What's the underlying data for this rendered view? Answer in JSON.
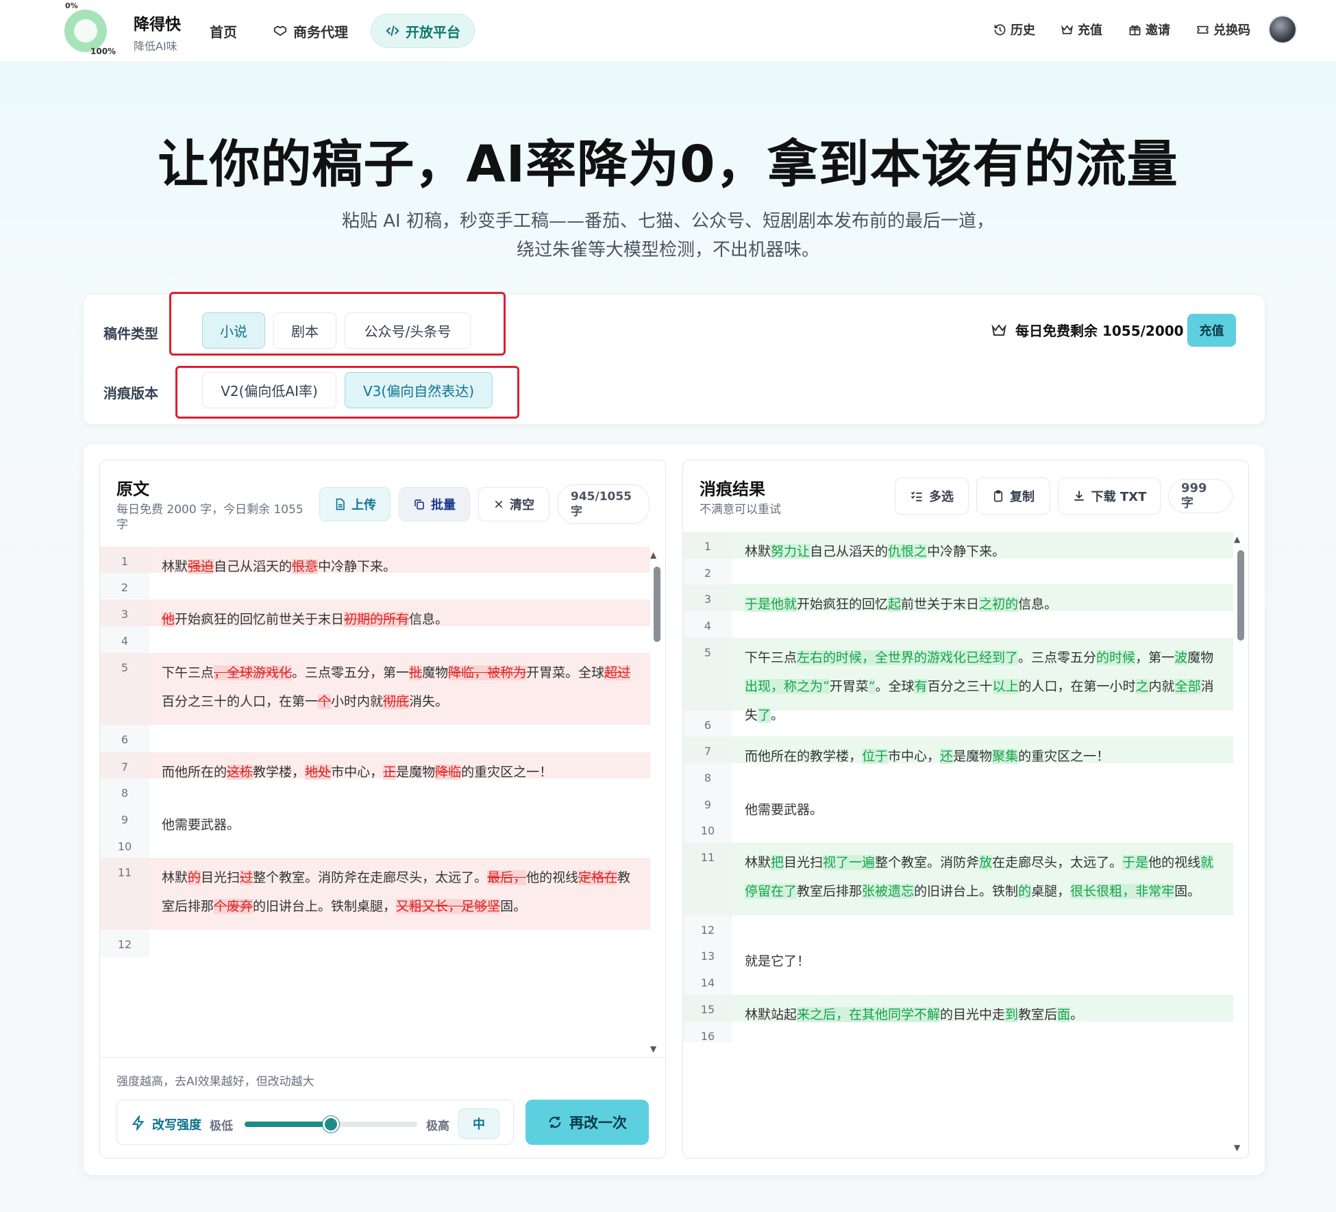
{
  "header": {
    "progress_top": "0%",
    "progress_bottom": "100%",
    "brand_name": "降得快",
    "brand_sub": "降低AI味",
    "nav": [
      "首页",
      "商务代理",
      "开放平台"
    ],
    "right": [
      "历史",
      "充值",
      "邀请",
      "兑换码"
    ]
  },
  "hero": {
    "title": "让你的稿子，AI率降为0，拿到本该有的流量",
    "sub1": "粘贴 AI 初稿，秒变手工稿——番茄、七猫、公众号、短剧剧本发布前的最后一道，",
    "sub2": "绕过朱雀等大模型检测，不出机器味。"
  },
  "settings": {
    "type_label": "稿件类型",
    "types": [
      "小说",
      "剧本",
      "公众号/头条号"
    ],
    "version_label": "消痕版本",
    "versions": [
      "V2(偏向低AI率)",
      "V3(偏向自然表达)"
    ],
    "quota": "每日免费剩余 1055/2000 字",
    "recharge": "充值"
  },
  "left": {
    "title": "原文",
    "sub": "每日免费 2000 字，今日剩余 1055 字",
    "upload": "上传",
    "batch": "批量",
    "clear": "清空",
    "count": "945/1055 字",
    "hint": "强度越高，去AI效果越好，但改动越大",
    "strength_label": "改写强度",
    "low": "极低",
    "high": "极高",
    "level": "中",
    "strength_value": 0.5,
    "again": "再改一次"
  },
  "right": {
    "title": "消痕结果",
    "sub": "不满意可以重试",
    "multi": "多选",
    "copy": "复制",
    "download": "下载 TXT",
    "count": "999 字"
  },
  "colors": {
    "accent": "#5dcfdf",
    "teal_text": "#0e7490",
    "deleted": "#dc2626",
    "inserted": "#16a34a",
    "highlight_box": "#e11d2e"
  },
  "left_lines": [
    {
      "n": "1",
      "segs": [
        [
          "",
          "林默"
        ],
        [
          "d",
          "强迫"
        ],
        [
          "",
          "自己从滔天的"
        ],
        [
          "d",
          "恨意"
        ],
        [
          "",
          "中冷静下来。"
        ]
      ]
    },
    {
      "n": "2",
      "segs": []
    },
    {
      "n": "3",
      "segs": [
        [
          "d",
          "他"
        ],
        [
          "",
          "开始疯狂的回忆前世关于末日"
        ],
        [
          "d",
          "初期的所有"
        ],
        [
          "",
          "信息。"
        ]
      ]
    },
    {
      "n": "4",
      "segs": []
    },
    {
      "n": "5",
      "segs": [
        [
          "",
          "下午三点"
        ],
        [
          "d",
          "，全球游戏化"
        ],
        [
          "",
          "。三点零五分，第一"
        ],
        [
          "d",
          "批"
        ],
        [
          "",
          "魔物"
        ],
        [
          "d",
          "降临，被称为"
        ],
        [
          "",
          "开胃菜。全球"
        ],
        [
          "d",
          "超过"
        ],
        [
          "",
          "百分之三十的人口，在第一"
        ],
        [
          "d",
          "个"
        ],
        [
          "",
          "小时内就"
        ],
        [
          "d",
          "彻底"
        ],
        [
          "",
          "消失。"
        ]
      ]
    },
    {
      "n": "6",
      "segs": []
    },
    {
      "n": "7",
      "segs": [
        [
          "",
          "而他所在的"
        ],
        [
          "d",
          "这栋"
        ],
        [
          "",
          "教学楼，"
        ],
        [
          "d",
          "地处"
        ],
        [
          "",
          "市中心，"
        ],
        [
          "d",
          "正"
        ],
        [
          "",
          "是魔物"
        ],
        [
          "d",
          "降临"
        ],
        [
          "",
          "的重灾区之一！"
        ]
      ]
    },
    {
      "n": "8",
      "segs": []
    },
    {
      "n": "9",
      "segs": [
        [
          "",
          "他需要武器。"
        ]
      ]
    },
    {
      "n": "10",
      "segs": []
    },
    {
      "n": "11",
      "segs": [
        [
          "",
          "林默"
        ],
        [
          "d",
          "的"
        ],
        [
          "",
          "目光扫"
        ],
        [
          "d",
          "过"
        ],
        [
          "",
          "整个教室。消防斧在走廊尽头，太远了。"
        ],
        [
          "d",
          "最后，"
        ],
        [
          "",
          "他的视线"
        ],
        [
          "d",
          "定格在"
        ],
        [
          "",
          "教室后排那"
        ],
        [
          "d",
          "个废弃"
        ],
        [
          "",
          "的旧讲台上。铁制桌腿，"
        ],
        [
          "d",
          "又粗又长，足够坚"
        ],
        [
          "",
          "固。"
        ]
      ]
    },
    {
      "n": "12",
      "segs": []
    }
  ],
  "right_lines": [
    {
      "n": "1",
      "segs": [
        [
          "",
          "林默"
        ],
        [
          "i",
          "努力让"
        ],
        [
          "",
          "自己从滔天的"
        ],
        [
          "i",
          "仇恨之"
        ],
        [
          "",
          "中冷静下来。"
        ]
      ]
    },
    {
      "n": "2",
      "segs": []
    },
    {
      "n": "3",
      "segs": [
        [
          "i",
          "于是他就"
        ],
        [
          "",
          "开始疯狂的回忆"
        ],
        [
          "i",
          "起"
        ],
        [
          "",
          "前世关于末日"
        ],
        [
          "i",
          "之初的"
        ],
        [
          "",
          "信息。"
        ]
      ]
    },
    {
      "n": "4",
      "segs": []
    },
    {
      "n": "5",
      "segs": [
        [
          "",
          "下午三点"
        ],
        [
          "i",
          "左右的时候，全世界的游戏化已经到了"
        ],
        [
          "",
          "。三点零五分"
        ],
        [
          "i",
          "的时候"
        ],
        [
          "",
          "，第一"
        ],
        [
          "i",
          "波"
        ],
        [
          "",
          "魔物"
        ],
        [
          "i",
          "出现，称之为“"
        ],
        [
          "",
          "开胃菜"
        ],
        [
          "i",
          "”"
        ],
        [
          "",
          "。全球"
        ],
        [
          "i",
          "有"
        ],
        [
          "",
          "百分之三十"
        ],
        [
          "i",
          "以上"
        ],
        [
          "",
          "的人口，在第一小时"
        ],
        [
          "i",
          "之"
        ],
        [
          "",
          "内就"
        ],
        [
          "i",
          "全部"
        ],
        [
          "",
          "消失"
        ],
        [
          "i",
          "了"
        ],
        [
          "",
          "。"
        ]
      ]
    },
    {
      "n": "6",
      "segs": []
    },
    {
      "n": "7",
      "segs": [
        [
          "",
          "而他所在的教学楼，"
        ],
        [
          "i",
          "位于"
        ],
        [
          "",
          "市中心，"
        ],
        [
          "i",
          "还"
        ],
        [
          "",
          "是魔物"
        ],
        [
          "i",
          "聚集"
        ],
        [
          "",
          "的重灾区之一！"
        ]
      ]
    },
    {
      "n": "8",
      "segs": []
    },
    {
      "n": "9",
      "segs": [
        [
          "",
          "他需要武器。"
        ]
      ]
    },
    {
      "n": "10",
      "segs": []
    },
    {
      "n": "11",
      "segs": [
        [
          "",
          "林默"
        ],
        [
          "i",
          "把"
        ],
        [
          "",
          "目光扫"
        ],
        [
          "i",
          "视了一遍"
        ],
        [
          "",
          "整个教室。消防斧"
        ],
        [
          "i",
          "放"
        ],
        [
          "",
          "在走廊尽头，太远了。"
        ],
        [
          "i",
          "于是"
        ],
        [
          "",
          "他的视线"
        ],
        [
          "i",
          "就停留在了"
        ],
        [
          "",
          "教室后排那"
        ],
        [
          "i",
          "张被遗忘"
        ],
        [
          "",
          "的旧讲台上。铁制"
        ],
        [
          "i",
          "的"
        ],
        [
          "",
          "桌腿，"
        ],
        [
          "i",
          "很长很粗，非常牢"
        ],
        [
          "",
          "固。"
        ]
      ]
    },
    {
      "n": "12",
      "segs": []
    },
    {
      "n": "13",
      "segs": [
        [
          "",
          "就是它了！"
        ]
      ]
    },
    {
      "n": "14",
      "segs": []
    },
    {
      "n": "15",
      "segs": [
        [
          "",
          "林默站起"
        ],
        [
          "i",
          "来之后，在其他同学不解"
        ],
        [
          "",
          "的目光中走"
        ],
        [
          "i",
          "到"
        ],
        [
          "",
          "教室后"
        ],
        [
          "i",
          "面"
        ],
        [
          "",
          "。"
        ]
      ]
    },
    {
      "n": "16",
      "segs": []
    }
  ]
}
